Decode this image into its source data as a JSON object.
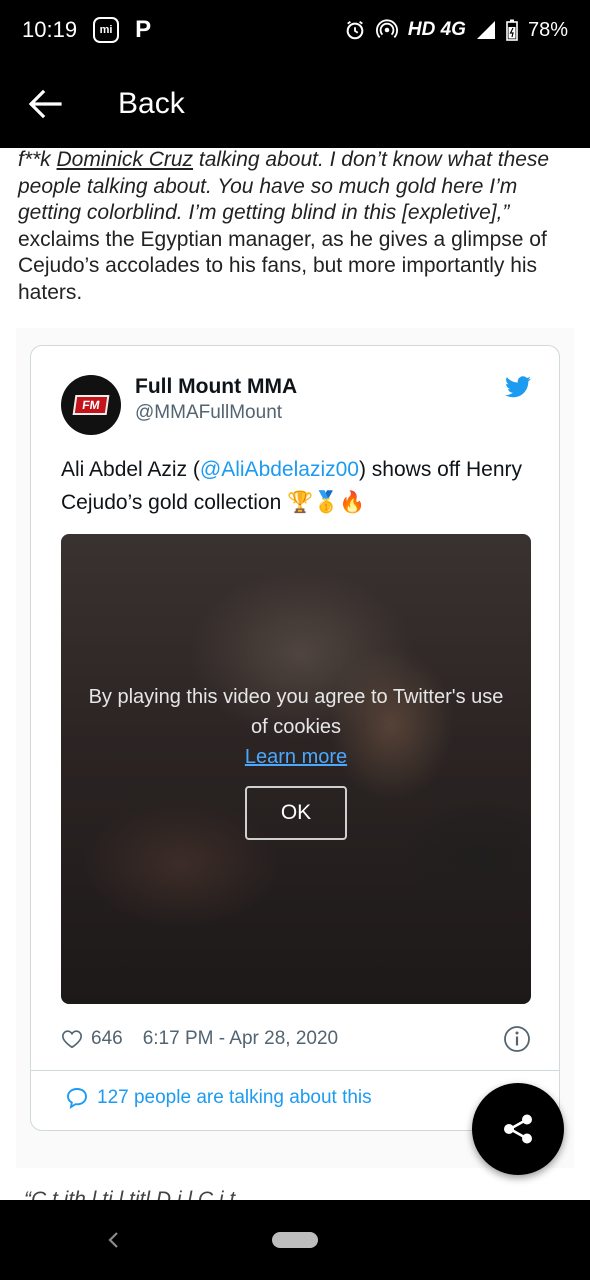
{
  "status_bar": {
    "time": "10:19",
    "badge": "mi",
    "p_icon": "P",
    "network": "HD 4G",
    "battery": "78%"
  },
  "app_bar": {
    "back_label": "Back"
  },
  "article": {
    "q1": "f**k ",
    "link": "Dominick Cruz",
    "q2": " talking about. I don’t know what these people talking about. You have so much gold here I’m getting colorblind. I’m getting blind in this [expletive],”",
    "rest": " exclaims the Egyptian manager, as he gives a glimpse of Cejudo’s accolades to his fans, but more importantly his haters.",
    "next_line": "“C   t  ith  l  ti  l titl    D  i l C  i  t"
  },
  "tweet": {
    "author_name": "Full Mount MMA",
    "author_handle": "@MMAFullMount",
    "avatar_text": "FM",
    "text_before": "Ali Abdel Aziz (",
    "mention": "@AliAbdelaziz00",
    "text_after": ") shows off Henry Cejudo’s gold collection ",
    "emoji": "🏆🥇🔥",
    "video": {
      "cookie_text": "By playing this video you agree to Twitter's use of cookies",
      "learn_more": "Learn more",
      "ok_label": "OK"
    },
    "like_count": "646",
    "timestamp": "6:17 PM - Apr 28, 2020",
    "talking": "127 people are talking about this"
  },
  "icons": {
    "back": "arrow-left",
    "bird": "twitter-bird",
    "like": "heart",
    "info": "info-circle",
    "talk": "speech-bubble",
    "share": "share"
  },
  "colors": {
    "accent": "#1d9bf0",
    "bar": "#000000"
  }
}
